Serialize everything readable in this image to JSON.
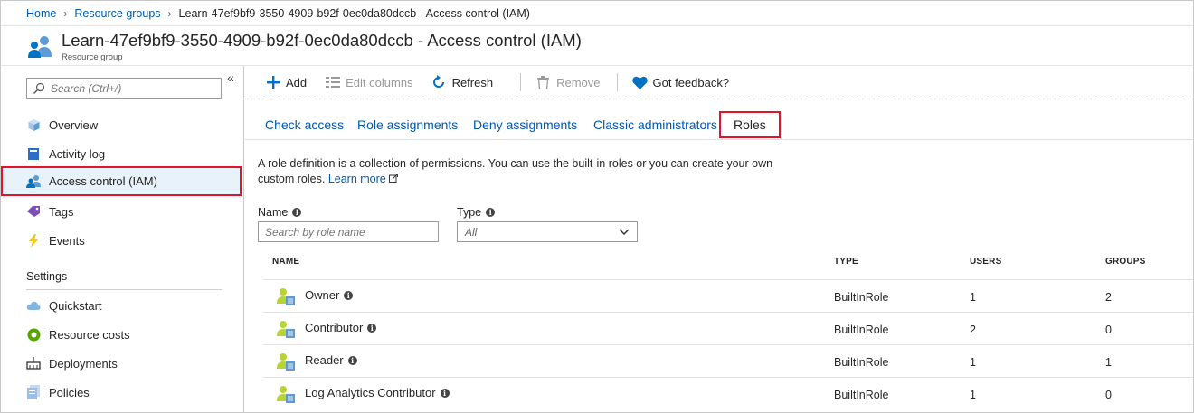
{
  "breadcrumb": {
    "home": "Home",
    "resource_groups": "Resource groups",
    "current": "Learn-47ef9bf9-3550-4909-b92f-0ec0da80dccb - Access control (IAM)"
  },
  "header": {
    "title": "Learn-47ef9bf9-3550-4909-b92f-0ec0da80dccb - Access control (IAM)",
    "subtitle": "Resource group",
    "icon": "resource-group-users-icon"
  },
  "sidebar": {
    "collapse_label": "«",
    "search_placeholder": "Search (Ctrl+/)",
    "items": [
      {
        "label": "Overview",
        "icon": "overview-cube-icon"
      },
      {
        "label": "Activity log",
        "icon": "activity-log-icon"
      },
      {
        "label": "Access control (IAM)",
        "icon": "iam-users-icon",
        "active": true
      },
      {
        "label": "Tags",
        "icon": "tag-icon"
      },
      {
        "label": "Events",
        "icon": "lightning-icon"
      }
    ],
    "settings_title": "Settings",
    "settings_items": [
      {
        "label": "Quickstart",
        "icon": "cloud-icon"
      },
      {
        "label": "Resource costs",
        "icon": "costs-icon"
      },
      {
        "label": "Deployments",
        "icon": "deployments-icon"
      },
      {
        "label": "Policies",
        "icon": "policies-icon"
      }
    ]
  },
  "toolbar": {
    "add": "Add",
    "edit_columns": "Edit columns",
    "refresh": "Refresh",
    "remove": "Remove",
    "feedback": "Got feedback?"
  },
  "tabs": [
    {
      "label": "Check access"
    },
    {
      "label": "Role assignments"
    },
    {
      "label": "Deny assignments"
    },
    {
      "label": "Classic administrators"
    },
    {
      "label": "Roles",
      "selected": true
    }
  ],
  "content": {
    "description": "A role definition is a collection of permissions. You can use the built-in roles or you can create your own custom roles.",
    "learn_more": "Learn more",
    "name_label": "Name",
    "name_placeholder": "Search by role name",
    "type_label": "Type",
    "type_value": "All"
  },
  "table": {
    "headers": {
      "name": "NAME",
      "type": "TYPE",
      "users": "USERS",
      "groups": "GROUPS"
    },
    "rows": [
      {
        "name": "Owner",
        "type": "BuiltInRole",
        "users": "1",
        "groups": "2"
      },
      {
        "name": "Contributor",
        "type": "BuiltInRole",
        "users": "2",
        "groups": "0"
      },
      {
        "name": "Reader",
        "type": "BuiltInRole",
        "users": "1",
        "groups": "1"
      },
      {
        "name": "Log Analytics Contributor",
        "type": "BuiltInRole",
        "users": "1",
        "groups": "0"
      }
    ]
  },
  "colors": {
    "link": "#0058ad",
    "highlight_border": "#e0142a",
    "active_bg": "#e8f2fb",
    "accent": "#0072c6"
  }
}
